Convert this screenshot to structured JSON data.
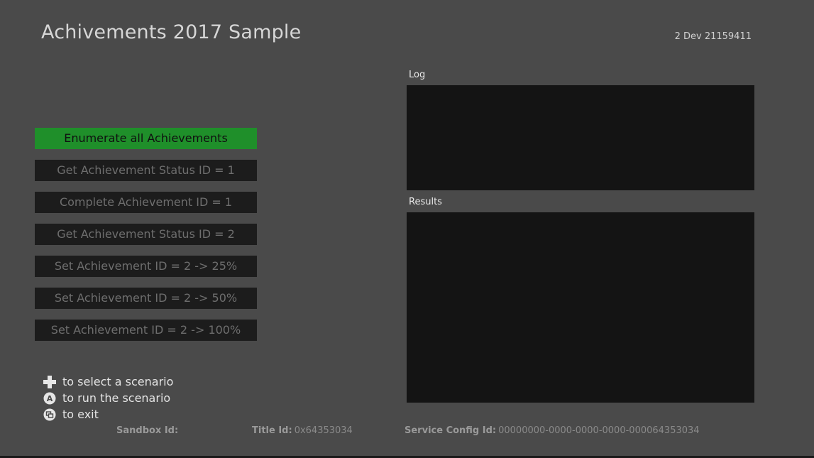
{
  "app": {
    "title": "Achivements 2017 Sample",
    "version": "2 Dev 21159411"
  },
  "menu": {
    "items": [
      {
        "label": "Enumerate all Achievements",
        "selected": true
      },
      {
        "label": "Get Achievement Status ID = 1",
        "selected": false
      },
      {
        "label": "Complete Achievement ID = 1",
        "selected": false
      },
      {
        "label": "Get Achievement Status ID = 2",
        "selected": false
      },
      {
        "label": "Set Achievement ID = 2 -> 25%",
        "selected": false
      },
      {
        "label": "Set Achievement ID = 2 -> 50%",
        "selected": false
      },
      {
        "label": "Set Achievement ID = 2 -> 100%",
        "selected": false
      }
    ]
  },
  "panels": {
    "log_label": "Log",
    "results_label": "Results"
  },
  "hints": {
    "select": "to select a scenario",
    "run": "to run the scenario",
    "exit": "to exit"
  },
  "footer": {
    "sandbox_label": "Sandbox Id:",
    "sandbox_value": "",
    "title_label": "Title Id:",
    "title_value": "0x64353034",
    "scid_label": "Service Config Id:",
    "scid_value": "00000000-0000-0000-0000-000064353034"
  },
  "colors": {
    "background": "#4a4a4a",
    "selected_button": "#1f8f2a",
    "button": "#1c1c1c",
    "panel": "#141414"
  }
}
